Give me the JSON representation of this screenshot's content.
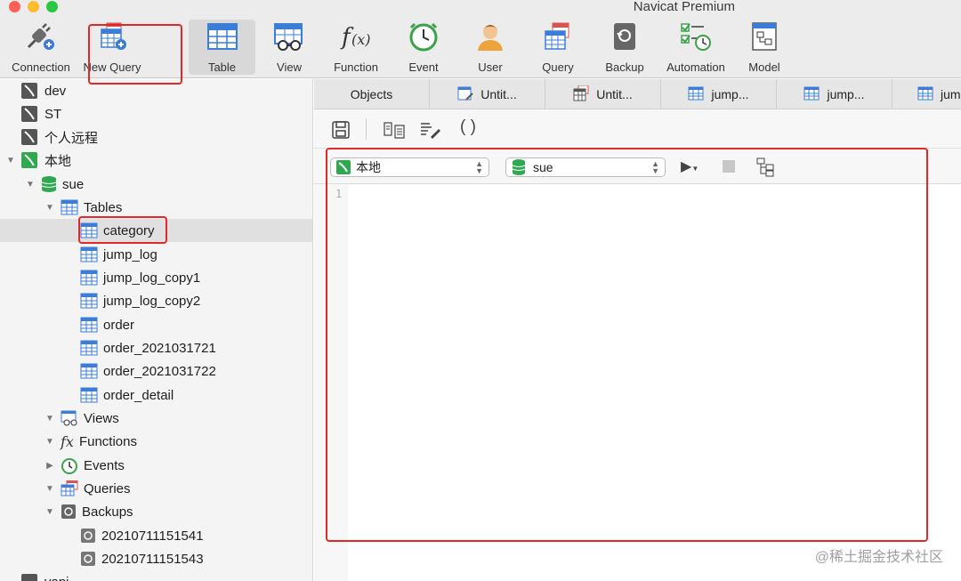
{
  "app": {
    "title": "Navicat Premium"
  },
  "toolbar": {
    "items": [
      {
        "label": "Connection",
        "icon": "plug-icon"
      },
      {
        "label": "New Query",
        "icon": "new-query-icon"
      },
      {
        "label": "Table",
        "icon": "table-icon"
      },
      {
        "label": "View",
        "icon": "view-icon"
      },
      {
        "label": "Function",
        "icon": "function-icon"
      },
      {
        "label": "Event",
        "icon": "clock-icon"
      },
      {
        "label": "User",
        "icon": "user-icon"
      },
      {
        "label": "Query",
        "icon": "query-icon"
      },
      {
        "label": "Backup",
        "icon": "backup-icon"
      },
      {
        "label": "Automation",
        "icon": "automation-icon"
      },
      {
        "label": "Model",
        "icon": "model-icon"
      }
    ],
    "active": "Table"
  },
  "sidebar": {
    "connections": [
      {
        "label": "dev"
      },
      {
        "label": "ST"
      },
      {
        "label": "个人远程"
      },
      {
        "label": "本地"
      }
    ],
    "database": "sue",
    "groups": {
      "tables": "Tables",
      "views": "Views",
      "functions": "Functions",
      "events": "Events",
      "queries": "Queries",
      "backups": "Backups"
    },
    "tables": [
      "category",
      "jump_log",
      "jump_log_copy1",
      "jump_log_copy2",
      "order",
      "order_2021031721",
      "order_2021031722",
      "order_detail"
    ],
    "selected_table": "category",
    "backups": [
      "20210711151541",
      "20210711151543"
    ],
    "partial_next": "yapi"
  },
  "tabs": [
    {
      "label": "Objects"
    },
    {
      "label": "Untit..."
    },
    {
      "label": "Untit..."
    },
    {
      "label": "jump..."
    },
    {
      "label": "jump..."
    },
    {
      "label": "jum"
    }
  ],
  "query": {
    "connection": "本地",
    "database": "sue",
    "line_number": "1"
  },
  "watermark": "@稀土掘金技术社区",
  "colors": {
    "highlight": "#e3282a",
    "table_icon": "#3b7dd8",
    "db_green": "#2fa84f"
  }
}
